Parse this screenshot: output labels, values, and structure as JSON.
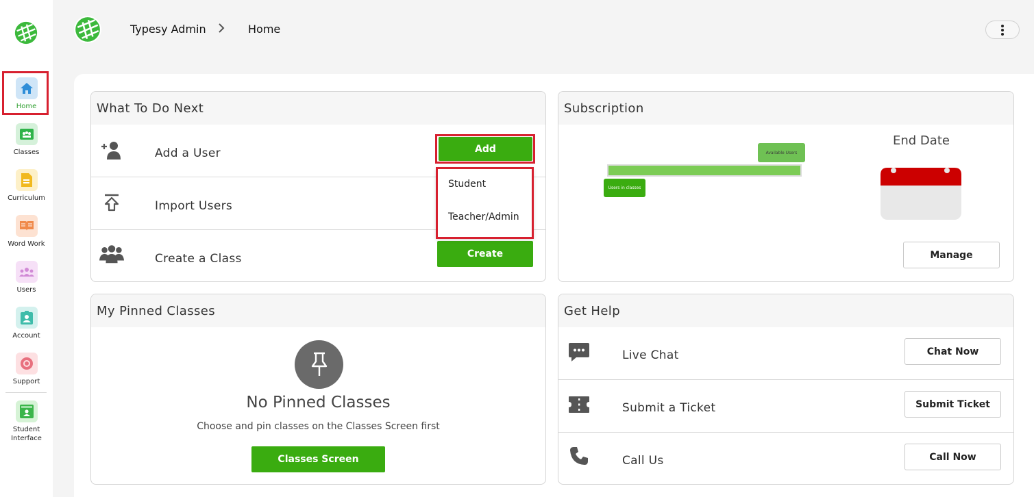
{
  "sidebar": {
    "items": [
      {
        "label": "Home",
        "icon": "home-icon",
        "bg": "#cfe5f7",
        "fg": "#2f8ed8"
      },
      {
        "label": "Classes",
        "icon": "classes-icon",
        "bg": "#d5f1da",
        "fg": "#2fb34a"
      },
      {
        "label": "Curriculum",
        "icon": "curriculum-icon",
        "bg": "#fdf0c8",
        "fg": "#f1b91f"
      },
      {
        "label": "Word Work",
        "icon": "book-icon",
        "bg": "#fde2d2",
        "fg": "#f08a4b"
      },
      {
        "label": "Users",
        "icon": "users-icon",
        "bg": "#f6e0f7",
        "fg": "#d18ad6"
      },
      {
        "label": "Account",
        "icon": "account-icon",
        "bg": "#d4f1ee",
        "fg": "#3fbcaa"
      },
      {
        "label": "Support",
        "icon": "support-icon",
        "bg": "#fde0e2",
        "fg": "#e8707e"
      },
      {
        "label": "Student Interface",
        "icon": "student-interface-icon",
        "bg": "#d6f3d6",
        "fg": "#3bb54a"
      }
    ]
  },
  "header": {
    "breadcrumb_root": "Typesy Admin",
    "breadcrumb_current": "Home"
  },
  "todo": {
    "title": "What To Do Next",
    "add_user": "Add a User",
    "add_button": "Add",
    "import_users": "Import Users",
    "create_class": "Create a Class",
    "create_button": "Create",
    "dropdown": [
      "Student",
      "Teacher/Admin"
    ]
  },
  "subscription": {
    "title": "Subscription",
    "available_users": "Available Users",
    "users_in_classes": "Users in classes",
    "end_date": "End Date",
    "manage_button": "Manage"
  },
  "pinned": {
    "title": "My Pinned Classes",
    "empty_title": "No Pinned Classes",
    "empty_text": "Choose and pin classes on the Classes Screen first",
    "button": "Classes Screen"
  },
  "help": {
    "title": "Get Help",
    "live_chat": "Live Chat",
    "chat_button": "Chat Now",
    "ticket": "Submit a Ticket",
    "ticket_button": "Submit Ticket",
    "call": "Call Us",
    "call_button": "Call Now"
  },
  "colors": {
    "brand_green": "#3aac10",
    "highlight_red": "#d7202f",
    "calendar_red": "#cc0000"
  }
}
